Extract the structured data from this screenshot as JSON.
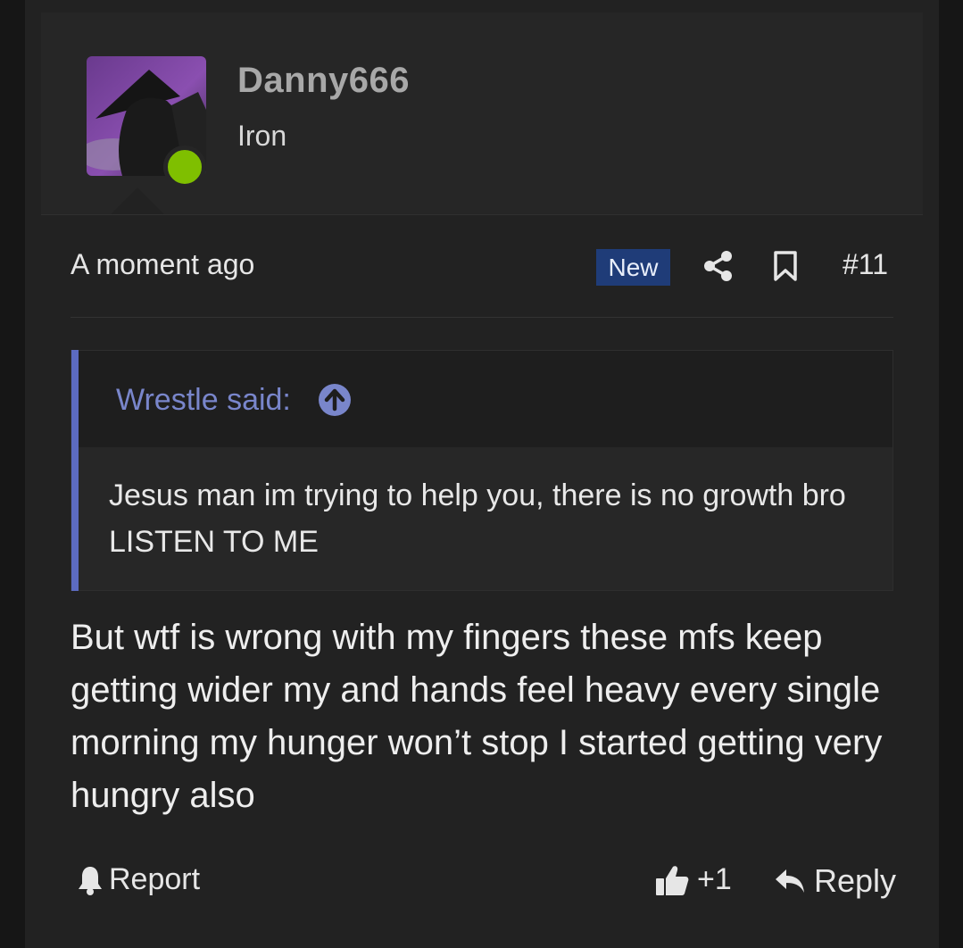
{
  "user": {
    "name": "Danny666",
    "title": "Iron",
    "online_color": "#7fbf00"
  },
  "post": {
    "time": "A moment ago",
    "badge": "New",
    "number": "#11",
    "body": "But wtf is wrong with my fingers these mfs keep getting wider my and hands feel heavy every single morning my hunger won’t stop I started getting very hungry also"
  },
  "quote": {
    "author": "Wrestle said:",
    "text": "Jesus man im trying to help you, there is no growth bro LISTEN TO ME",
    "accent": "#5c6bc0"
  },
  "actions": {
    "report": "Report",
    "like_count": "+1",
    "reply": "Reply"
  },
  "icons": [
    "share-icon",
    "bookmark-icon",
    "arrow-up-icon",
    "bell-icon",
    "thumbs-up-icon",
    "reply-icon"
  ]
}
